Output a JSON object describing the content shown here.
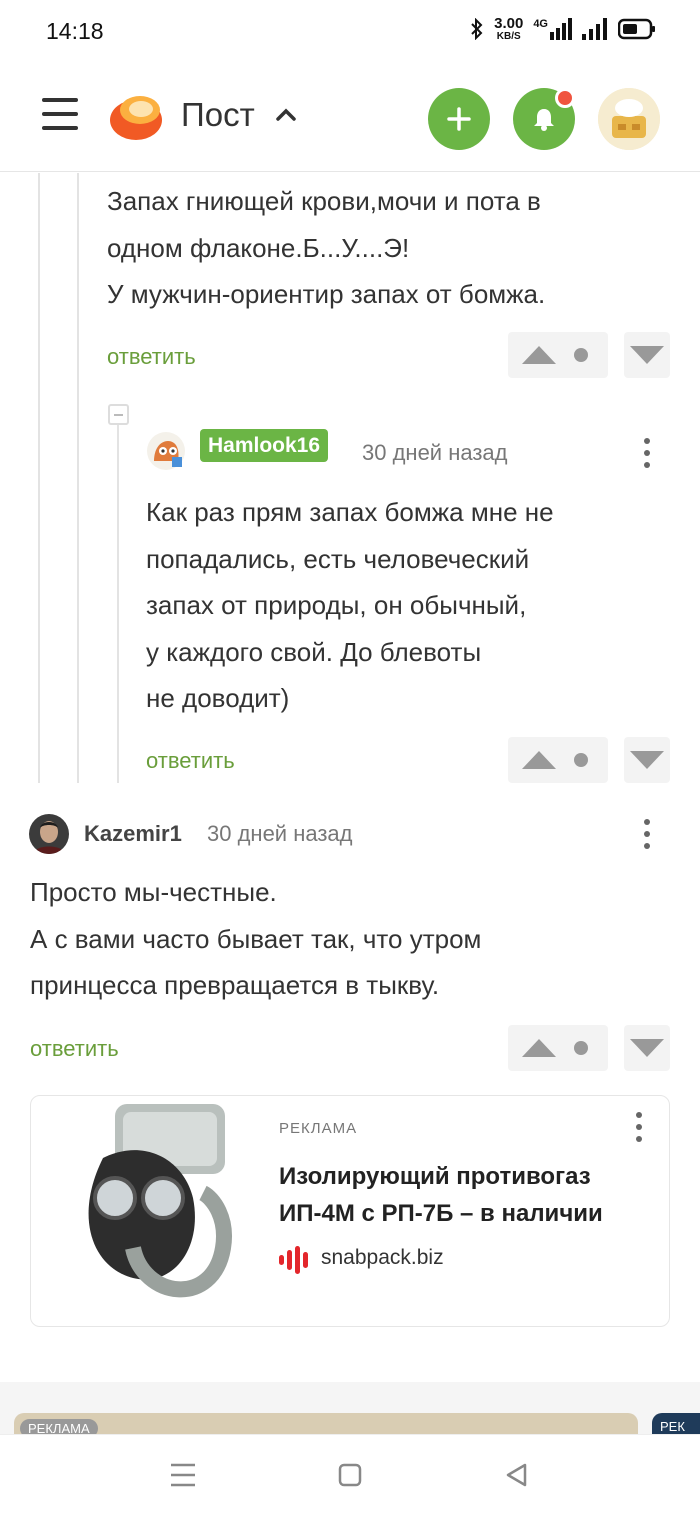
{
  "status": {
    "time": "14:18",
    "speed_value": "3.00",
    "speed_unit": "KB/S",
    "network": "4G"
  },
  "header": {
    "title": "Пост"
  },
  "comments": {
    "partial": {
      "text_lines": [
        "Запах гниющей крови,мочи и пота в",
        "одном флаконе.Б...У....Э!",
        "У мужчин-ориентир запах от бомжа."
      ],
      "reply_label": "ответить"
    },
    "nested": {
      "author": "Hamlook16",
      "time": "30 дней назад",
      "text_lines": [
        "Как раз прям запах бомжа мне не",
        "попадались, есть человеческий",
        "запах от природы, он обычный,",
        "у каждого свой. До блевоты",
        "не доводит)"
      ],
      "reply_label": "ответить"
    },
    "main": {
      "author": "Kazemir1",
      "time": "30 дней назад",
      "text_lines": [
        "Просто мы-честные.",
        "А с вами часто бывает так, что утром",
        "принцесса превращается в тыкву."
      ],
      "reply_label": "ответить"
    }
  },
  "ad": {
    "label": "РЕКЛАМА",
    "title_lines": [
      "Изолирующий противогаз",
      "ИП-4М с РП-7Б – в наличии"
    ],
    "domain": "snabpack.biz"
  },
  "ad_strip": {
    "label_left": "РЕКЛАМА",
    "label_right": "РЕК"
  },
  "colors": {
    "accent": "#6bb545",
    "link": "#6a9e3b",
    "notification": "#f0543f"
  },
  "icons": [
    "menu-icon",
    "pikabu-logo",
    "chevron-up-icon",
    "plus-icon",
    "bell-icon",
    "more-vertical-icon",
    "arrow-up-icon",
    "arrow-down-icon",
    "collapse-icon",
    "nav-menu-icon",
    "nav-home-icon",
    "nav-back-icon"
  ]
}
